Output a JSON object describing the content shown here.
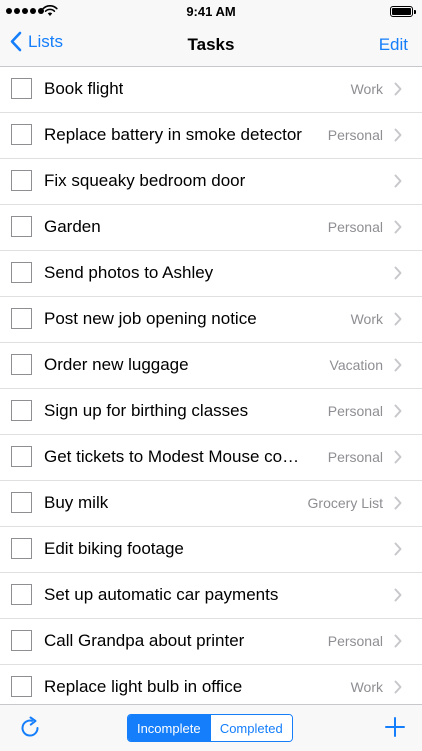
{
  "status_bar": {
    "time": "9:41 AM"
  },
  "nav": {
    "back_label": "Lists",
    "title": "Tasks",
    "edit_label": "Edit"
  },
  "tasks": [
    {
      "title": "Book flight",
      "category": "Work"
    },
    {
      "title": "Replace battery in smoke detector",
      "category": "Personal"
    },
    {
      "title": "Fix squeaky bedroom door",
      "category": ""
    },
    {
      "title": "Garden",
      "category": "Personal"
    },
    {
      "title": "Send photos to Ashley",
      "category": ""
    },
    {
      "title": "Post new job opening notice",
      "category": "Work"
    },
    {
      "title": "Order new luggage",
      "category": "Vacation"
    },
    {
      "title": "Sign up for birthing classes",
      "category": "Personal"
    },
    {
      "title": "Get tickets to Modest Mouse co…",
      "category": "Personal"
    },
    {
      "title": "Buy milk",
      "category": "Grocery List"
    },
    {
      "title": "Edit biking footage",
      "category": ""
    },
    {
      "title": "Set up automatic car payments",
      "category": ""
    },
    {
      "title": "Call Grandpa about printer",
      "category": "Personal"
    },
    {
      "title": "Replace light bulb in office",
      "category": "Work"
    }
  ],
  "toolbar": {
    "segment_incomplete": "Incomplete",
    "segment_completed": "Completed",
    "selected_segment": "Incomplete"
  },
  "colors": {
    "accent": "#147efb",
    "secondary_text": "#8e8e93",
    "separator": "#e0e0e0"
  },
  "icons": {
    "back": "chevron-left-icon",
    "refresh": "refresh-icon",
    "add": "plus-icon",
    "disclosure": "chevron-right-icon"
  }
}
